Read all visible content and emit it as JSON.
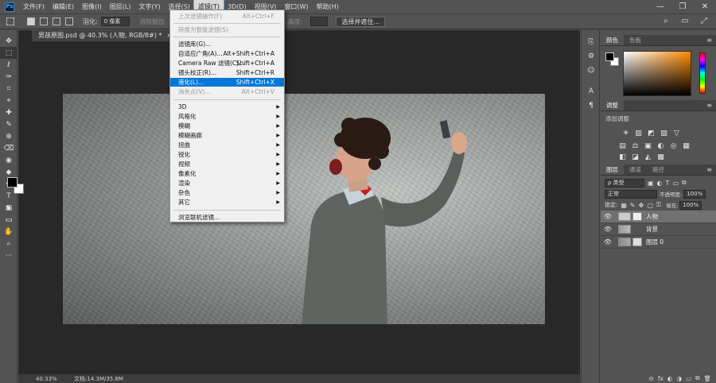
{
  "menubar": {
    "logo": "Ps",
    "items": [
      "文件(F)",
      "编辑(E)",
      "图像(I)",
      "图层(L)",
      "文字(Y)",
      "选择(S)",
      "滤镜(T)",
      "3D(D)",
      "视图(V)",
      "窗口(W)",
      "帮助(H)"
    ],
    "active_index": 6,
    "window_controls": [
      "—",
      "❐",
      "✕"
    ]
  },
  "options": {
    "feather_label": "羽化:",
    "feather_value": "0 像素",
    "anti_alias_label": "消除锯齿",
    "height_label": "高度:",
    "select_mask_button": "选择并遮住...",
    "right_icons": [
      "⌕",
      "▭",
      "⤢"
    ]
  },
  "document": {
    "tab_title": "男孩原图.psd @ 40.3% (人物, RGB/8#) *",
    "tab_close": "×",
    "zoom": "40.33%",
    "doc_info": "文档:14.3M/35.8M"
  },
  "filter_menu": {
    "items": [
      {
        "label": "上次滤镜操作(F)",
        "shortcut": "Alt+Ctrl+F",
        "disabled": true
      },
      {
        "label": "转换为智能滤镜(S)",
        "shortcut": "",
        "disabled": true
      },
      {
        "label": "滤镜库(G)...",
        "shortcut": ""
      },
      {
        "label": "自适应广角(A)...",
        "shortcut": "Alt+Shift+Ctrl+A"
      },
      {
        "label": "Camera Raw 滤镜(C)...",
        "shortcut": "Shift+Ctrl+A"
      },
      {
        "label": "镜头校正(R)...",
        "shortcut": "Shift+Ctrl+R"
      },
      {
        "label": "液化(L)...",
        "shortcut": "Shift+Ctrl+X",
        "highlighted": true
      },
      {
        "label": "消失点(V)...",
        "shortcut": "Alt+Ctrl+V",
        "disabled": true
      },
      {
        "label": "3D",
        "submenu": true
      },
      {
        "label": "风格化",
        "submenu": true
      },
      {
        "label": "模糊",
        "submenu": true
      },
      {
        "label": "模糊画廊",
        "submenu": true
      },
      {
        "label": "扭曲",
        "submenu": true
      },
      {
        "label": "锐化",
        "submenu": true
      },
      {
        "label": "视频",
        "submenu": true
      },
      {
        "label": "像素化",
        "submenu": true
      },
      {
        "label": "渲染",
        "submenu": true
      },
      {
        "label": "杂色",
        "submenu": true
      },
      {
        "label": "其它",
        "submenu": true
      },
      {
        "label": "浏览联机滤镜..."
      }
    ]
  },
  "color_panel": {
    "tabs": [
      "颜色",
      "色板"
    ],
    "picker_hue": "#ff8a00"
  },
  "adjustments_panel": {
    "tab": "调整",
    "title": "添加调整",
    "row1": [
      "☀",
      "▥",
      "◩",
      "▨",
      "▽"
    ],
    "row2": [
      "▤",
      "⚖",
      "▣",
      "◐",
      "◎",
      "▦"
    ],
    "row3": [
      "◧",
      "◪",
      "◭",
      "▩"
    ]
  },
  "layers_panel": {
    "tabs": [
      "图层",
      "通道",
      "路径"
    ],
    "filter_kind": "ρ 类型",
    "blend_mode": "正常",
    "opacity_label": "不透明度:",
    "opacity_value": "100%",
    "lock_label": "锁定:",
    "fill_label": "填充:",
    "fill_value": "100%",
    "layers": [
      {
        "name": "人物",
        "selected": true
      },
      {
        "name": "背景",
        "selected": false
      },
      {
        "name": "图层 0",
        "selected": false
      }
    ],
    "bottom_icons": [
      "⊝",
      "fx",
      "◐",
      "◑",
      "▭",
      "⧉",
      "🗑"
    ]
  },
  "toolbar": {
    "tools": [
      "✥",
      "⬚",
      "ℓ",
      "✑",
      "⌗",
      "⌖",
      "✚",
      "✎",
      "⊕",
      "⌫",
      "◉",
      "◆",
      "✒",
      "T",
      "↖",
      "▭",
      "✋",
      "⌕"
    ],
    "more": "···"
  },
  "colors": {
    "highlight": "#0078d7",
    "canvas_bg": "#282828",
    "ui_gray": "#535353"
  }
}
